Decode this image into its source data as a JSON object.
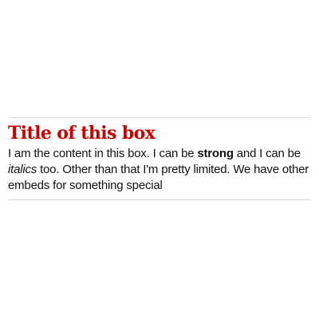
{
  "embed": {
    "title": "Title of this box",
    "content": {
      "part1": "I am the content in this box. I can be ",
      "strong": "strong",
      "part2": " and I can be ",
      "italics": "italics",
      "part3": " too. Other than that I'm pretty limited. We have other embeds for something special"
    }
  },
  "colors": {
    "title": "#c70000",
    "text": "#121212",
    "rule": "#dcdcdc",
    "background": "#ffffff"
  }
}
